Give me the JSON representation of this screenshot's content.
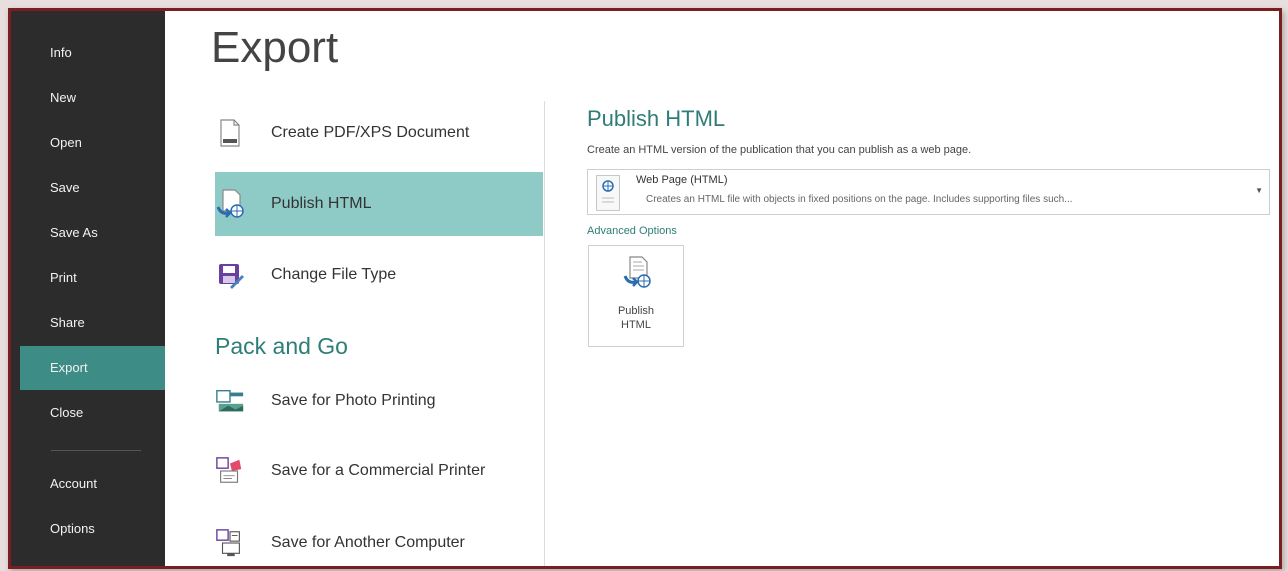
{
  "sidebar": {
    "items": [
      {
        "label": "Info"
      },
      {
        "label": "New"
      },
      {
        "label": "Open"
      },
      {
        "label": "Save"
      },
      {
        "label": "Save As"
      },
      {
        "label": "Print"
      },
      {
        "label": "Share"
      },
      {
        "label": "Export",
        "active": true
      },
      {
        "label": "Close"
      },
      {
        "label": "Account"
      },
      {
        "label": "Options"
      }
    ]
  },
  "main": {
    "title": "Export",
    "options": [
      {
        "label": "Create PDF/XPS Document",
        "icon": "pdf-document-icon"
      },
      {
        "label": "Publish HTML",
        "icon": "publish-html-icon",
        "active": true
      },
      {
        "label": "Change File Type",
        "icon": "change-file-type-icon"
      }
    ],
    "pack_heading": "Pack and Go",
    "pack_options": [
      {
        "label": "Save for Photo Printing",
        "icon": "photo-printing-icon"
      },
      {
        "label": "Save for a Commercial Printer",
        "icon": "commercial-printer-icon"
      },
      {
        "label": "Save for Another Computer",
        "icon": "another-computer-icon"
      }
    ]
  },
  "detail": {
    "title": "Publish HTML",
    "description": "Create an HTML version of the publication that you can publish as a web page.",
    "dropdown": {
      "selected": "Web Page (HTML)",
      "subtext": "Creates an HTML file with objects in fixed positions on the page. Includes supporting files such..."
    },
    "advanced_link": "Advanced Options",
    "publish_button": {
      "line1": "Publish",
      "line2": "HTML"
    }
  },
  "colors": {
    "sidebar_bg": "#2c2c2c",
    "sidebar_active": "#3d8d86",
    "option_active": "#8fcbc6",
    "accent_text": "#2e7d77",
    "frame_border": "#7a1f1f"
  }
}
